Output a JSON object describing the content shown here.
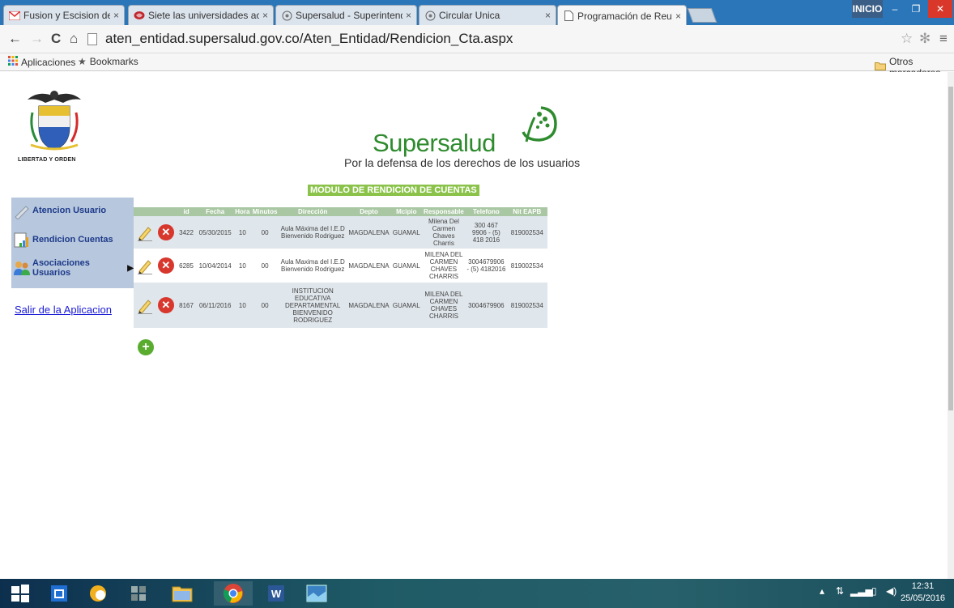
{
  "browser": {
    "tabs": [
      {
        "label": "Fusion y Escision de EPS -",
        "icon": "gmail-icon"
      },
      {
        "label": "Siete las universidades ac",
        "icon": "red-brand-icon"
      },
      {
        "label": "Supersalud - Superintend",
        "icon": "supersalud-icon"
      },
      {
        "label": "Circular Unica",
        "icon": "supersalud-icon"
      },
      {
        "label": "Programación de Reunion",
        "icon": "page-icon"
      }
    ],
    "window_label": "INICIO",
    "url": "aten_entidad.supersalud.gov.co/Aten_Entidad/Rendicion_Cta.aspx",
    "bookmarks": {
      "apps": "Aplicaciones",
      "bookmarks": "Bookmarks",
      "other": "Otros marcadores"
    }
  },
  "header": {
    "crest_caption": "LIBERTAD Y ORDEN",
    "logo_text": "Supersalud",
    "tagline": "Por la defensa de los derechos de los usuarios",
    "module_title": "MODULO DE RENDICION DE CUENTAS"
  },
  "sidebar": {
    "items": [
      {
        "label": "Atencion Usuario"
      },
      {
        "label": "Rendicion Cuentas"
      },
      {
        "label": "Asociaciones Usuarios"
      }
    ],
    "logout": "Salir de la Aplicacion"
  },
  "table": {
    "headers": [
      "id",
      "Fecha",
      "Hora",
      "Minutos",
      "Dirección",
      "Depto",
      "Mcipio",
      "Responsable",
      "Telefono",
      "Nit EAPB"
    ],
    "rows": [
      {
        "id": "3422",
        "fecha": "05/30/2015",
        "hora": "10",
        "minutos": "00",
        "direccion": "Aula Máxima del I.E.D Bienvenido Rodriguez",
        "depto": "MAGDALENA",
        "mcipio": "GUAMAL",
        "responsable": "Milena Del Carmen Chaves Charris",
        "telefono": "300 467 9906 - (5) 418 2016",
        "nit": "819002534"
      },
      {
        "id": "6285",
        "fecha": "10/04/2014",
        "hora": "10",
        "minutos": "00",
        "direccion": "Aula Maxima del I.E.D Bienvenido Rodriguez",
        "depto": "MAGDALENA",
        "mcipio": "GUAMAL",
        "responsable": "MILENA DEL CARMEN CHAVES CHARRIS",
        "telefono": "3004679906 - (5) 4182016",
        "nit": "819002534"
      },
      {
        "id": "8167",
        "fecha": "06/11/2016",
        "hora": "10",
        "minutos": "00",
        "direccion": "INSTITUCION EDUCATIVA DEPARTAMENTAL BIENVENIDO RODRIGUEZ",
        "depto": "MAGDALENA",
        "mcipio": "GUAMAL",
        "responsable": "MILENA DEL CARMEN CHAVES CHARRIS",
        "telefono": "3004679906",
        "nit": "819002534"
      }
    ]
  },
  "taskbar": {
    "time": "12:31",
    "date": "25/05/2016"
  }
}
